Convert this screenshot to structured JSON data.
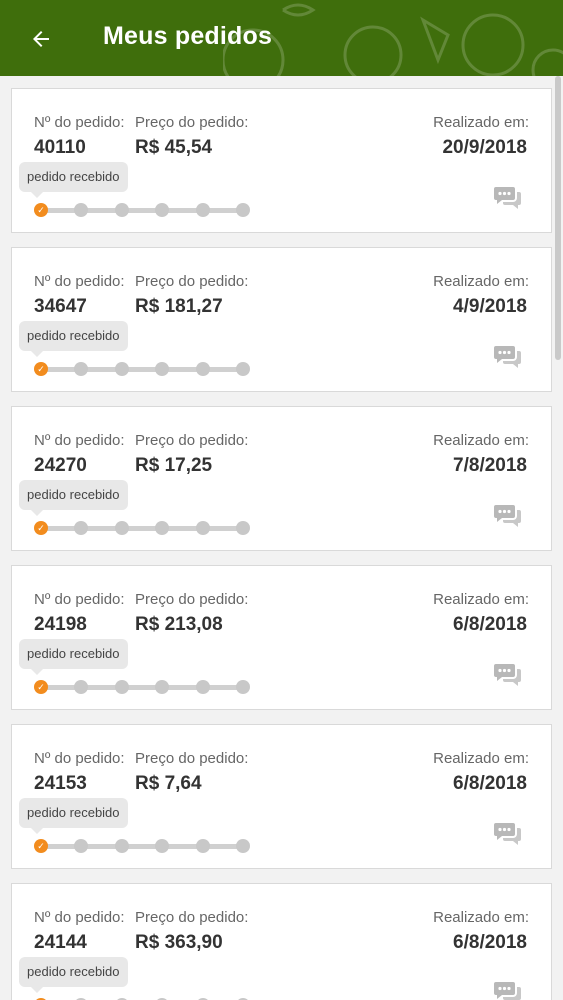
{
  "header": {
    "title": "Meus pedidos",
    "back_icon": "arrow-left-icon",
    "background_color": "#3f6e0c"
  },
  "labels": {
    "order_number": "Nº do pedido:",
    "order_price": "Preço do pedido:",
    "placed_on": "Realizado em:"
  },
  "status_color": "#f28c1e",
  "orders": [
    {
      "number": "40110",
      "price": "R$ 45,54",
      "date": "20/9/2018",
      "status": "pedido recebido",
      "steps_done": 1,
      "steps_total": 6
    },
    {
      "number": "34647",
      "price": "R$ 181,27",
      "date": "4/9/2018",
      "status": "pedido recebido",
      "steps_done": 1,
      "steps_total": 6
    },
    {
      "number": "24270",
      "price": "R$ 17,25",
      "date": "7/8/2018",
      "status": "pedido recebido",
      "steps_done": 1,
      "steps_total": 6
    },
    {
      "number": "24198",
      "price": "R$ 213,08",
      "date": "6/8/2018",
      "status": "pedido recebido",
      "steps_done": 1,
      "steps_total": 6
    },
    {
      "number": "24153",
      "price": "R$ 7,64",
      "date": "6/8/2018",
      "status": "pedido recebido",
      "steps_done": 1,
      "steps_total": 6
    },
    {
      "number": "24144",
      "price": "R$ 363,90",
      "date": "6/8/2018",
      "status": "pedido recebido",
      "steps_done": 1,
      "steps_total": 6
    }
  ]
}
